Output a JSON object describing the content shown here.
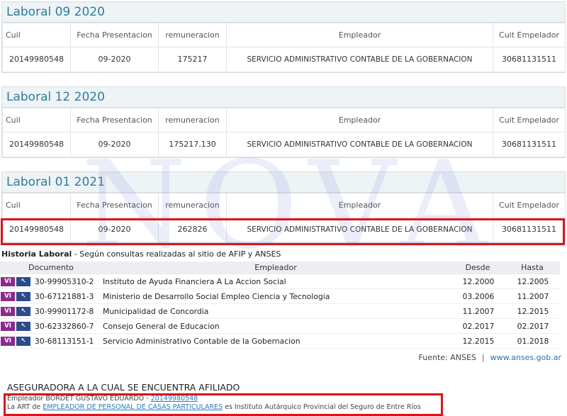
{
  "panels": [
    {
      "title": "Laboral 09 2020",
      "headers": {
        "cuil": "Cuil",
        "fecha": "Fecha Presentacion",
        "remuneracion": "remuneracion",
        "empleador": "Empleador",
        "cuit": "Cuit Empelador"
      },
      "row": {
        "cuil": "20149980548",
        "fecha": "09-2020",
        "remuneracion": "175217",
        "empleador": "SERVICIO ADMINISTRATIVO CONTABLE DE LA GOBERNACION",
        "cuit": "30681131511"
      }
    },
    {
      "title": "Laboral 12 2020",
      "headers": {
        "cuil": "Cuil",
        "fecha": "Fecha Presentacion",
        "remuneracion": "remuneracion",
        "empleador": "Empleador",
        "cuit": "Cuit Empelador"
      },
      "row": {
        "cuil": "20149980548",
        "fecha": "09-2020",
        "remuneracion": "175217.130",
        "empleador": "SERVICIO ADMINISTRATIVO CONTABLE DE LA GOBERNACION",
        "cuit": "30681131511"
      }
    },
    {
      "title": "Laboral 01 2021",
      "headers": {
        "cuil": "Cuil",
        "fecha": "Fecha Presentacion",
        "remuneracion": "remuneracion",
        "empleador": "Empleador",
        "cuit": "Cuit Empelador"
      },
      "row": {
        "cuil": "20149980548",
        "fecha": "09-2020",
        "remuneracion": "262826",
        "empleador": "SERVICIO ADMINISTRATIVO CONTABLE DE LA GOBERNACION",
        "cuit": "30681131511"
      }
    }
  ],
  "watermark": "NOVA",
  "historia": {
    "title": "Historia Laboral",
    "subtitle": " - Según consultas realizadas al sitio de AFIP y ANSES",
    "headers": {
      "documento": "Documento",
      "empleador": "Empleador",
      "desde": "Desde",
      "hasta": "Hasta"
    },
    "badge_vi": "VI",
    "badge_cursor": "↖",
    "rows": [
      {
        "doc": "30-99905310-2",
        "emp": "Instituto de Ayuda Financiera A La Accion Social",
        "desde": "12.2000",
        "hasta": "12.2005"
      },
      {
        "doc": "30-67121881-3",
        "emp": "Ministerio de Desarrollo Social Empleo Ciencia y Tecnologia",
        "desde": "03.2006",
        "hasta": "11.2007"
      },
      {
        "doc": "30-99901172-8",
        "emp": "Municipalidad de Concordia",
        "desde": "11.2007",
        "hasta": "12.2015"
      },
      {
        "doc": "30-62332860-7",
        "emp": "Consejo General de Educacion",
        "desde": "02.2017",
        "hasta": "02.2017"
      },
      {
        "doc": "30-68113151-1",
        "emp": "Servicio Administrativo Contable de la Gobernacion",
        "desde": "12.2015",
        "hasta": "01.2018"
      }
    ],
    "fuente_label": "Fuente: ANSES",
    "fuente_sep": "|",
    "fuente_link": "www.anses.gob.ar"
  },
  "aseguradora": {
    "title": "ASEGURADORA A LA CUAL SE ENCUENTRA AFILIADO",
    "line1_prefix": "Empleador BORDET GUSTAVO EDUARDO - ",
    "line1_link": "20149980548",
    "line2_prefix": "La ART de ",
    "line2_link": "EMPLEADOR DE PERSONAL DE CASAS PARTICULARES",
    "line2_suffix": " es Instituto Autárquico Provincial del Seguro de Entre Ríos"
  },
  "colors": {
    "highlight": "#d8141b",
    "title": "#2f7d9a",
    "badge_vi": "#8a2b8c",
    "badge_cursor": "#2b4c8a"
  }
}
